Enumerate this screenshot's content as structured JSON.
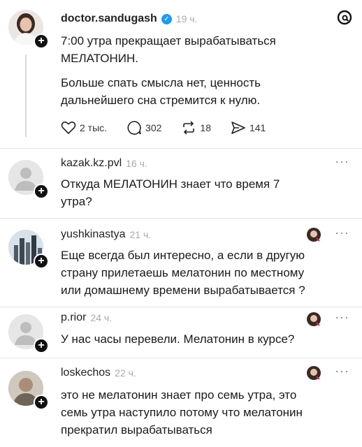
{
  "app_icon": "threads-logo-icon",
  "main_post": {
    "username": "doctor.sandugash",
    "verified": true,
    "time": "19 ч.",
    "line1": "7:00 утра прекращает вырабатываться",
    "line2": "МЕЛАТОНИН.",
    "line3": "Больше спать смысла нет, ценность",
    "line4": "дальнейшего сна стремится к нулю.",
    "likes": "2 тыс.",
    "comments": "302",
    "reposts": "18",
    "shares": "141"
  },
  "replies": [
    {
      "username": "kazak.kz.pvl",
      "time": "16 ч.",
      "lines": [
        "Откуда МЕЛАТОНИН  знает что время 7",
        "утра?"
      ]
    },
    {
      "username": "yushkinastya",
      "time": "21 ч.",
      "lines": [
        "Еще всегда был интересно, а если в другую",
        "страну прилетаешь мелатонин по местному",
        "или домашнему времени вырабатывается ?"
      ]
    },
    {
      "username": "p.rior",
      "time": "24 ч.",
      "lines": [
        "У нас часы перевели. Мелатонин в курсе?"
      ]
    },
    {
      "username": "loskechos",
      "time": "22 ч.",
      "lines": [
        "это не мелатонин знает про семь утра, это",
        "семь утра наступило потому что мелатонин",
        "прекратил вырабатываться"
      ]
    }
  ],
  "more_label": "···"
}
